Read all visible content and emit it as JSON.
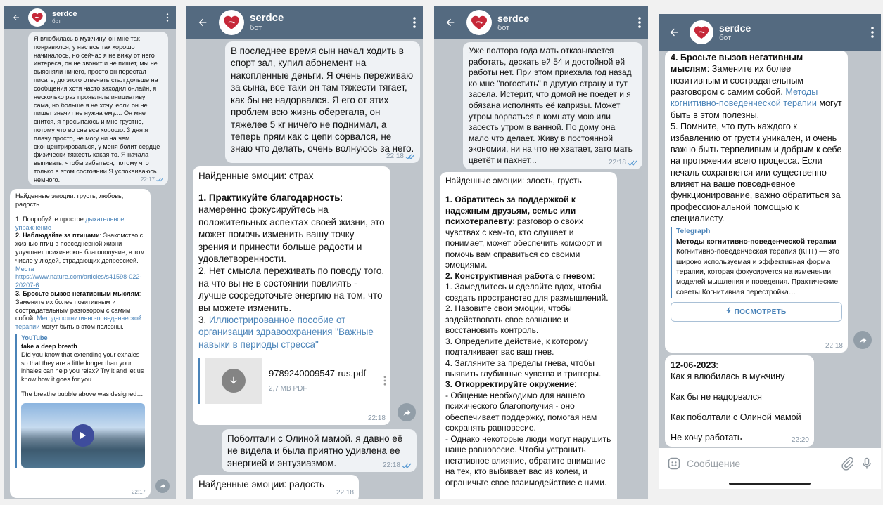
{
  "chat": {
    "title": "serdce",
    "subtitle": "бот"
  },
  "p1": {
    "out_message": "Я влюбилась в мужчину, он мне так понравился, у нас все так хорошо начиналось, но сейчас я не вижу от него интереса, он не звонит и не пишет, мы не выясняли ничего, просто он перестал писать, до этого отвечать стал дольше на сообщения хотя часто заходил онлайн, я несколько раз проявляла инициативу сама, но больше я не хочу, если он не пишет значит не нужна ему.... Он мне снится, я просыпаюсь и мне грустно, потому что во сне все хорошо. 3 дня я плачу просто, не могу ни на чем сконцентрироваться, у меня болит сердце физически тяжесть какая то. Я начала выпивать, чтобы забыться, потому что только в этом состоянии Я успокаиваюсь немного.",
    "out_time": "22:17",
    "in_header": "Найденные эмоции: грусть, любовь, радость",
    "in_item1_prefix": "1. Попробуйте простое ",
    "in_item1_link": "дыхательное упражнение",
    "in_item2_bold": "2. Наблюдайте за птицами",
    "in_item2_text": ": Знакомство с жизнью птиц в повседневной жизни улучшает психическое благополучие, в том числе у людей, страдающих депрессией. ",
    "in_item2_link": "Места",
    "in_url": "https://www.nature.com/articles/s41598-022-20207-6",
    "in_item3_bold": "3. Бросьте вызов негативным мыслям",
    "in_item3_text": ": Замените их более позитивным и сострадательным разговором с самим собой. ",
    "in_item3_link": "Методы когнитивно-поведенческой терапии",
    "in_item3_tail": " могут быть в этом полезны.",
    "preview_site": "YouTube",
    "preview_title": "take a deep breath",
    "preview_desc": "Did you know that extending your exhales so that they are a little longer than your inhales can help you relax? Try it and let us know how it goes for you.",
    "preview_desc2": "The breathe bubble above was designed…",
    "in_time": "22:17"
  },
  "p2": {
    "out_message": "В последнее время сын начал ходить в спорт зал, купил абонемент на накопленные деньги. Я очень переживаю за сына, все таки он там тяжести тягает, как бы не надорвался. Я его от этих проблем всю жизнь оберегала, он тяжелее 5 кг ничего не поднимал, а теперь прям как с цепи сорвался, не знаю что делать, очень волнуюсь за него.",
    "out_time": "22:18",
    "in_header": "Найденные эмоции: страх",
    "in_item1_bold": "1. Практикуйте благодарность",
    "in_item1_text": ": намеренно фокусируйтесь на положительных аспектах своей жизни, это может помочь изменить вашу точку зрения и принести больше радости и удовлетворенности.",
    "in_item2_text": "2. Нет смысла переживать по поводу того, на что вы не в состоянии повлиять - лучше сосредоточьте энергию на том, что вы можете изменить.",
    "in_item3_prefix": "3. ",
    "in_item3_link": "Иллюстрированное пособие от организации здравоохранения \"Важные навыки в периоды стресса\"",
    "doc_name": "9789240009547-rus.pdf",
    "doc_size": "2,7 MB PDF",
    "in_time": "22:18",
    "out2_message": "Поболтали с Олиной мамой. я давно её не видела и была приятно удивлена ее энергией и энтузиазмом.",
    "out2_time": "22:18",
    "in2_text": "Найденные эмоции: радость",
    "in2_time": "22:18"
  },
  "p3": {
    "out_message": "Уже полтора года мать отказывается работать, дескать ей 54 и достойной ей работы нет. При этом приехала год назад ко мне \"погостить\" в другую страну и тут засела. Истерит, что домой не поедет и я обязана исполнять её капризы. Может утром ворваться в комнату мою или засесть утром в ванной. По дому она мало что делает. Живу в постоянной экономии, ни на что не хватает, зато мать цветёт и пахнет...",
    "out_time": "22:18",
    "in_header": "Найденные эмоции: злость, грусть",
    "in_item1_bold": "1. Обратитесь за поддержкой к надежным друзьям, семье или психотерапевту",
    "in_item1_text": ": разговор о своих чувствах с кем-то, кто слушает и понимает, может обеспечить комфорт и помочь вам справиться со своими эмоциями.",
    "in_item2_bold": "2. Конструктивная работа с гневом",
    "in_item2_colon": ":",
    "in_sub1": "1. Замедлитесь и сделайте вдох, чтобы создать пространство для размышлений.",
    "in_sub2": "2. Назовите свои эмоции, чтобы задействовать свое сознание и восстановить контроль.",
    "in_sub3": "3. Определите действие, к которому подталкивает вас ваш гнев.",
    "in_sub4": "4. Загляните за пределы гнева, чтобы выявить глубинные чувства и триггеры.",
    "in_item3_bold": "3. Откорректируйте окружение",
    "in_item3_colon": ":",
    "in_dash1": "- Общение необходимо для нашего психического благополучия - оно обеспечивает поддержку, помогая нам сохранять равновесие.",
    "in_dash2": "- Однако некоторые люди могут нарушить наше равновесие. Чтобы устранить негативное влияние, обратите внимание на тех, кто выбивает вас из колеи, и ограничьте свое взаимодействие с ними."
  },
  "p4": {
    "in_item4_bold": "4. Бросьте вызов негативным мыслям",
    "in_item4_text": ": Замените их более позитивным и сострадательным разговором с самим собой. ",
    "in_item4_link": "Методы когнитивно-поведенческой терапии",
    "in_item4_tail": " могут быть в этом полезны.",
    "in_item5_text": "5. Помните, что путь каждого к избавлению от грусти уникален, и очень важно быть терпеливым и добрым к себе на протяжении всего процесса. Если печаль сохраняется или существенно влияет на ваше повседневное функционирование, важно обратиться за профессиональной помощью к специалисту.",
    "preview_site": "Telegraph",
    "preview_title": "Методы когнитивно-поведенческой терапии",
    "preview_desc": "Когнитивно-поведенческая терапия (КПТ) — это широко используемая и эффективная форма терапии, которая фокусируется на изменении моделей мышления и поведения. Практические советы Когнитивная перестройка…",
    "view_button": "ПОСМОТРЕТЬ",
    "in_time": "22:18",
    "note_date": "12-06-2023",
    "note_colon": ":",
    "note_line1": "Как я влюбилась в мужчину",
    "note_line2": "Как бы не надорвался",
    "note_line3": "Как поболтали с Олиной мамой",
    "note_line4": "Не хочу работать",
    "note_time": "22:20",
    "input_placeholder": "Сообщение"
  },
  "colors": {
    "header": "#546a80",
    "chat_bg": "#bfc5cb",
    "link": "#4a83b8",
    "incoming": "#ffffff",
    "outgoing": "#eff2f5"
  }
}
